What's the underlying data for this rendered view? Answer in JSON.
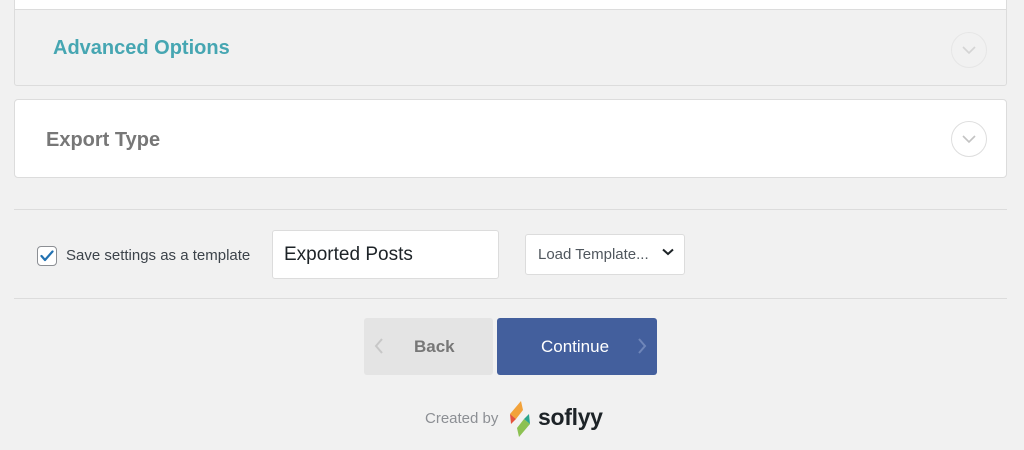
{
  "advanced_options": {
    "title": "Advanced Options",
    "expand_icon": "chevron-down-icon",
    "title_color": "#46a6b2"
  },
  "export_type": {
    "title": "Export Type",
    "expand_icon": "chevron-down-icon"
  },
  "template": {
    "save_checked": true,
    "save_label": "Save settings as a template",
    "name_value": "Exported Posts",
    "load_select_value": "Load Template..."
  },
  "nav": {
    "back_label": "Back",
    "continue_label": "Continue",
    "continue_color": "#435f9d"
  },
  "footer": {
    "created_by": "Created by",
    "brand": "soflyy"
  }
}
